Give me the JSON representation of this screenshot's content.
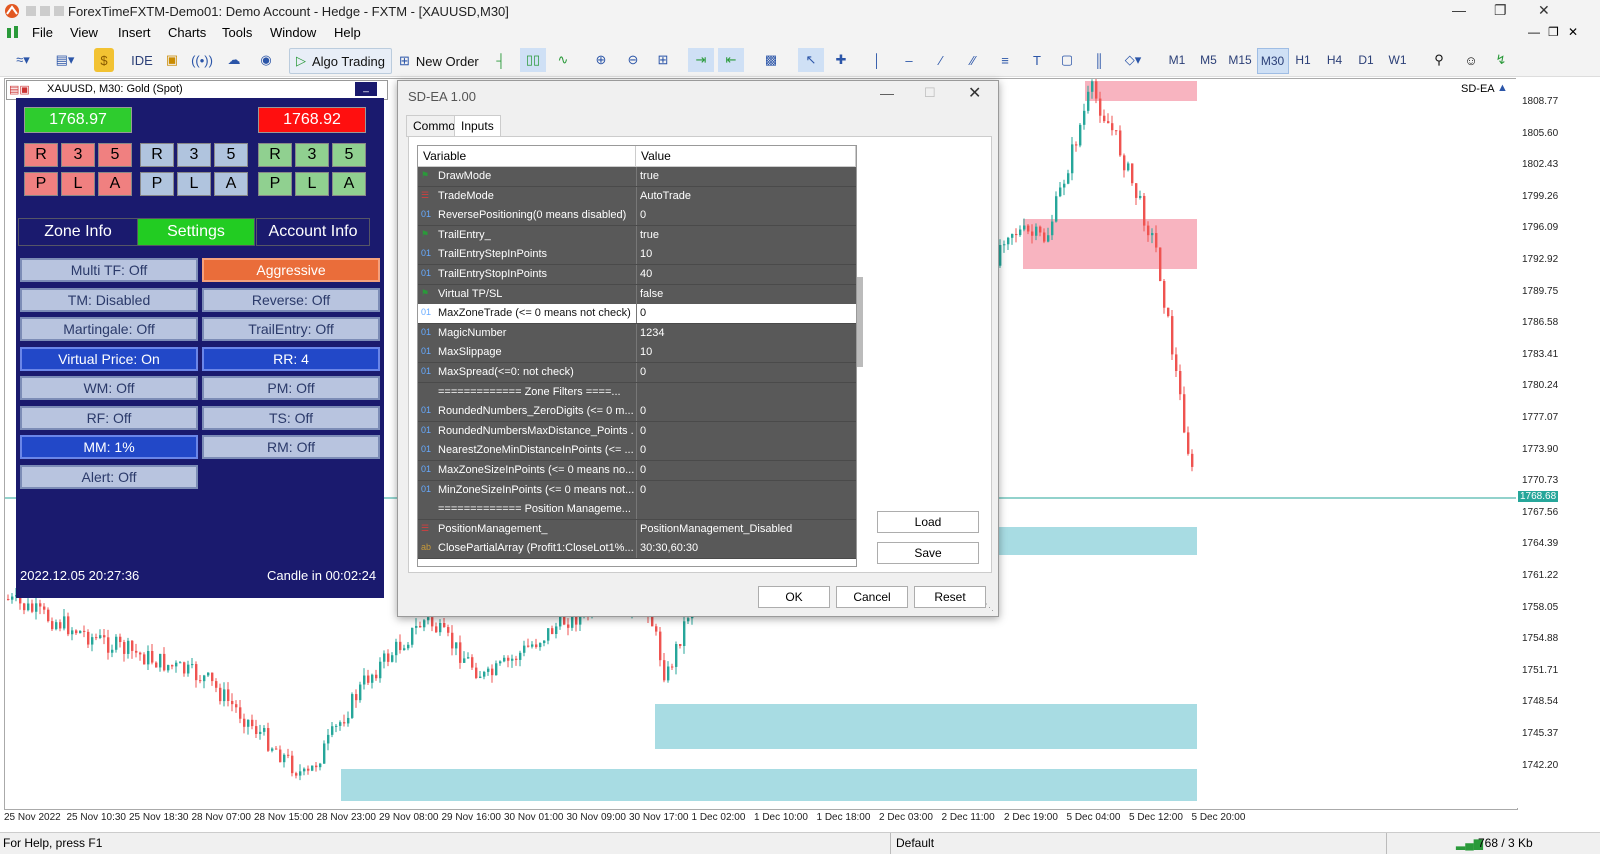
{
  "window": {
    "title": "ForexTimeFXTM-Demo01: Demo Account - Hedge - FXTM - [XAUUSD,M30]"
  },
  "menu": [
    "File",
    "View",
    "Insert",
    "Charts",
    "Tools",
    "Window",
    "Help"
  ],
  "toolbar": {
    "ide": "IDE",
    "algo": "Algo Trading",
    "new_order": "New Order",
    "timeframes": [
      "M1",
      "M5",
      "M15",
      "M30",
      "H1",
      "H4",
      "D1",
      "W1"
    ],
    "active_tf": "M30"
  },
  "chart": {
    "symbol_label": "XAUUSD, M30:  Gold (Spot)",
    "ea_label": "SD-EA",
    "current_price": "1768.68",
    "prices": [
      "1808.77",
      "1805.60",
      "1802.43",
      "1799.26",
      "1796.09",
      "1792.92",
      "1789.75",
      "1786.58",
      "1783.41",
      "1780.24",
      "1777.07",
      "1773.90",
      "1770.73",
      "1767.56",
      "1764.39",
      "1761.22",
      "1758.05",
      "1754.88",
      "1751.71",
      "1748.54",
      "1745.37",
      "1742.20"
    ],
    "dates": [
      "25 Nov 2022",
      "25 Nov 10:30",
      "25 Nov 18:30",
      "28 Nov 07:00",
      "28 Nov 15:00",
      "28 Nov 23:00",
      "29 Nov 08:00",
      "29 Nov 16:00",
      "30 Nov 01:00",
      "30 Nov 09:00",
      "30 Nov 17:00",
      "1 Dec 02:00",
      "1 Dec 10:00",
      "1 Dec 18:00",
      "2 Dec 03:00",
      "2 Dec 11:00",
      "2 Dec 19:00",
      "5 Dec 04:00",
      "5 Dec 12:00",
      "5 Dec 20:00"
    ],
    "colors": {
      "bull": "#26a69a",
      "bear": "#ef5350",
      "supply": "#f8b4c0",
      "demand": "#a8dce3"
    }
  },
  "panel": {
    "bid": "1768.97",
    "ask": "1768.92",
    "row1": [
      "R",
      "3",
      "5",
      "R",
      "3",
      "5",
      "R",
      "3",
      "5"
    ],
    "row2": [
      "P",
      "L",
      "A",
      "P",
      "L",
      "A",
      "P",
      "L",
      "A"
    ],
    "tabs": [
      "Zone Info",
      "Settings",
      "Account Info"
    ],
    "buttons": [
      {
        "label": "Multi TF: Off",
        "style": ""
      },
      {
        "label": "Aggressive",
        "style": "orange"
      },
      {
        "label": "TM: Disabled",
        "style": ""
      },
      {
        "label": "Reverse: Off",
        "style": ""
      },
      {
        "label": "Martingale: Off",
        "style": ""
      },
      {
        "label": "TrailEntry: Off",
        "style": ""
      },
      {
        "label": "Virtual Price: On",
        "style": "blue"
      },
      {
        "label": "RR: 4",
        "style": "blue"
      },
      {
        "label": "WM: Off",
        "style": ""
      },
      {
        "label": "PM: Off",
        "style": ""
      },
      {
        "label": "RF: Off",
        "style": ""
      },
      {
        "label": "TS: Off",
        "style": ""
      },
      {
        "label": "MM: 1%",
        "style": "blue"
      },
      {
        "label": "RM: Off",
        "style": ""
      },
      {
        "label": "Alert: Off",
        "style": ""
      }
    ],
    "datetime": "2022.12.05 20:27:36",
    "candle": "Candle in 00:02:24"
  },
  "dialog": {
    "title": "SD-EA 1.00",
    "tabs": [
      "Common",
      "Inputs"
    ],
    "col_variable": "Variable",
    "col_value": "Value",
    "rows": [
      {
        "icon": "flag",
        "name": "DrawMode",
        "value": "true"
      },
      {
        "icon": "enum",
        "name": "TradeMode",
        "value": "AutoTrade"
      },
      {
        "icon": "01",
        "name": "ReversePositioning(0 means disabled)",
        "value": "0"
      },
      {
        "icon": "flag",
        "name": "TrailEntry_",
        "value": "true"
      },
      {
        "icon": "01",
        "name": "TrailEntryStepInPoints",
        "value": "10"
      },
      {
        "icon": "01",
        "name": "TrailEntryStopInPoints",
        "value": "40"
      },
      {
        "icon": "flag",
        "name": "Virtual TP/SL",
        "value": "false"
      },
      {
        "icon": "01",
        "name": "MaxZoneTrade (<= 0 means not check)",
        "value": "0",
        "hl": true
      },
      {
        "icon": "01",
        "name": "MagicNumber",
        "value": "1234"
      },
      {
        "icon": "01",
        "name": "MaxSlippage",
        "value": "10"
      },
      {
        "icon": "01",
        "name": "MaxSpread(<=0: not check)",
        "value": "0"
      },
      {
        "icon": "",
        "name": "============= Zone Filters ====...",
        "value": ""
      },
      {
        "icon": "01",
        "name": "RoundedNumbers_ZeroDigits (<= 0 m...",
        "value": "0"
      },
      {
        "icon": "01",
        "name": "RoundedNumbersMaxDistance_Points ...",
        "value": "0"
      },
      {
        "icon": "01",
        "name": "NearestZoneMinDistanceInPoints (<= ...",
        "value": "0"
      },
      {
        "icon": "01",
        "name": "MaxZoneSizeInPoints (<= 0 means no...",
        "value": "0"
      },
      {
        "icon": "01",
        "name": "MinZoneSizeInPoints (<= 0 means not...",
        "value": "0"
      },
      {
        "icon": "",
        "name": "============= Position Manageme...",
        "value": ""
      },
      {
        "icon": "enum",
        "name": "PositionManagement_",
        "value": "PositionManagement_Disabled"
      },
      {
        "icon": "ab",
        "name": "ClosePartialArray (Profit1:CloseLot1%...",
        "value": "30:30,60:30"
      }
    ],
    "load": "Load",
    "save": "Save",
    "ok": "OK",
    "cancel": "Cancel",
    "reset": "Reset"
  },
  "status": {
    "help": "For Help, press F1",
    "profile": "Default",
    "traffic": "768 / 3 Kb"
  }
}
